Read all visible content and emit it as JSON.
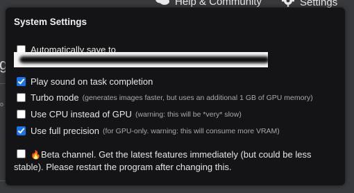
{
  "topbar": {
    "help_label": "Help & Community",
    "settings_label": "Settings"
  },
  "background": {
    "glyph": "g",
    "mini_text": "o"
  },
  "panel": {
    "title": "System Settings",
    "options": {
      "auto_save": {
        "label": "Automatically save to",
        "checked": false
      },
      "play_sound": {
        "label": "Play sound on task completion",
        "checked": true
      },
      "turbo": {
        "label": "Turbo mode",
        "hint": "(generates images faster, but uses an additional 1 GB of GPU memory)",
        "checked": false
      },
      "use_cpu": {
        "label": "Use CPU instead of GPU",
        "hint": "(warning: this will be *very* slow)",
        "checked": false
      },
      "full_precision": {
        "label": "Use full precision",
        "hint": "(for GPU-only. warning: this will consume more VRAM)",
        "checked": true
      },
      "beta": {
        "label": "Beta channel. Get the latest features immediately (but could be less stable). Please restart the program after changing this.",
        "checked": false
      }
    }
  },
  "colors": {
    "accent": "#1a73e8",
    "panel_bg": "#141416",
    "hint_text": "#a9a9a9"
  }
}
